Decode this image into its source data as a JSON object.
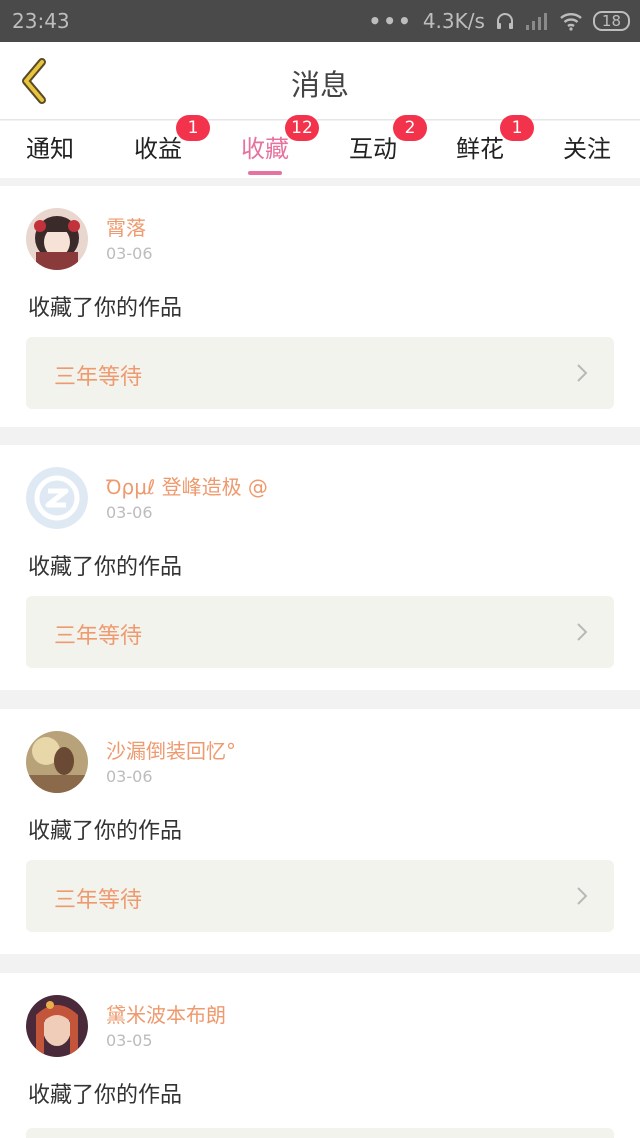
{
  "status_bar": {
    "time": "23:43",
    "dots": "•••",
    "network_speed": "4.3K/s",
    "battery": "18"
  },
  "header": {
    "title": "消息"
  },
  "tabs": [
    {
      "label": "通知",
      "badge": ""
    },
    {
      "label": "收益",
      "badge": "1"
    },
    {
      "label": "收藏",
      "badge": "12",
      "active": true
    },
    {
      "label": "互动",
      "badge": "2"
    },
    {
      "label": "鲜花",
      "badge": "1"
    },
    {
      "label": "关注",
      "badge": ""
    }
  ],
  "messages": [
    {
      "user": "霄落",
      "date": "03-06",
      "action": "收藏了你的作品",
      "work_title": "三年等待",
      "avatar": "anime-girl-avatar"
    },
    {
      "user": "Ꝺρμℓ 登峰造极 @",
      "date": "03-06",
      "action": "收藏了你的作品",
      "work_title": "三年等待",
      "avatar": "qq-default-avatar"
    },
    {
      "user": "沙漏倒装回忆°",
      "date": "03-06",
      "action": "收藏了你的作品",
      "work_title": "三年等待",
      "avatar": "photo-avatar"
    },
    {
      "user": "黛米波本布朗",
      "date": "03-05",
      "action": "收藏了你的作品",
      "work_title": "",
      "avatar": "anime-girl-avatar"
    }
  ],
  "colors": {
    "accent": "#e6739f",
    "username": "#ee9a6e",
    "badge": "#f2334b",
    "back_arrow": "#e8c53a"
  }
}
